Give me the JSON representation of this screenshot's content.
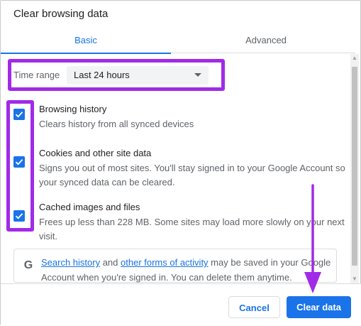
{
  "dialog": {
    "title": "Clear browsing data"
  },
  "tabs": [
    {
      "label": "Basic",
      "active": true
    },
    {
      "label": "Advanced",
      "active": false
    }
  ],
  "time_range": {
    "label": "Time range",
    "value": "Last 24 hours"
  },
  "options": [
    {
      "title": "Browsing history",
      "description": "Clears history from all synced devices",
      "checked": true
    },
    {
      "title": "Cookies and other site data",
      "description": "Signs you out of most sites. You'll stay signed in to your Google Account so your synced data can be cleared.",
      "checked": true
    },
    {
      "title": "Cached images and files",
      "description": "Frees up less than 228 MB. Some sites may load more slowly on your next visit.",
      "checked": true
    }
  ],
  "info": {
    "icon": "google-g-icon",
    "link1": "Search history",
    "text1": " and ",
    "link2": "other forms of activity",
    "text2": " may be saved in your Google Account when you're signed in. You can delete them anytime."
  },
  "footer": {
    "cancel_label": "Cancel",
    "clear_label": "Clear data"
  },
  "colors": {
    "accent": "#1a73e8",
    "highlight": "#a12ae8"
  }
}
